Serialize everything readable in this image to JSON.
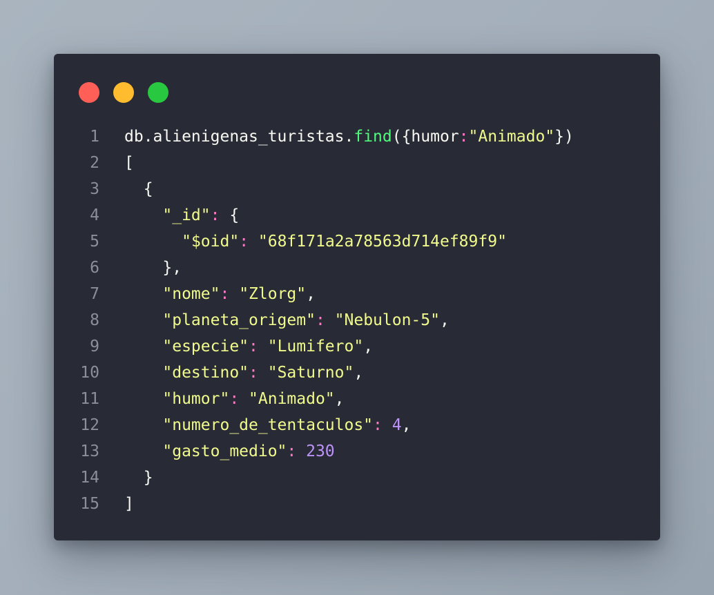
{
  "window": {
    "traffic_lights": [
      {
        "name": "close",
        "color": "#ff5f57"
      },
      {
        "name": "minimize",
        "color": "#febc2e"
      },
      {
        "name": "maximize",
        "color": "#28c840"
      }
    ],
    "theme": {
      "background": "#282a36",
      "default": "#f8f8f2",
      "function": "#50fa7b",
      "string": "#f1fa8c",
      "colon": "#ff79c6",
      "number": "#bd93f9",
      "line_number": "#8b8f99"
    }
  },
  "code": {
    "lines": [
      {
        "num": "1",
        "tokens": [
          {
            "t": "db.alienigenas_turistas.",
            "c": "default"
          },
          {
            "t": "find",
            "c": "func"
          },
          {
            "t": "({humor",
            "c": "default"
          },
          {
            "t": ":",
            "c": "colon"
          },
          {
            "t": "\"Animado\"",
            "c": "string"
          },
          {
            "t": "})",
            "c": "default"
          }
        ]
      },
      {
        "num": "2",
        "tokens": [
          {
            "t": "[",
            "c": "default"
          }
        ]
      },
      {
        "num": "3",
        "tokens": [
          {
            "t": "  {",
            "c": "default"
          }
        ]
      },
      {
        "num": "4",
        "tokens": [
          {
            "t": "    ",
            "c": "default"
          },
          {
            "t": "\"_id\"",
            "c": "key"
          },
          {
            "t": ": ",
            "c": "colon"
          },
          {
            "t": "{",
            "c": "default"
          }
        ]
      },
      {
        "num": "5",
        "tokens": [
          {
            "t": "      ",
            "c": "default"
          },
          {
            "t": "\"$oid\"",
            "c": "key"
          },
          {
            "t": ": ",
            "c": "colon"
          },
          {
            "t": "\"68f171a2a78563d714ef89f9\"",
            "c": "string"
          }
        ]
      },
      {
        "num": "6",
        "tokens": [
          {
            "t": "    },",
            "c": "default"
          }
        ]
      },
      {
        "num": "7",
        "tokens": [
          {
            "t": "    ",
            "c": "default"
          },
          {
            "t": "\"nome\"",
            "c": "key"
          },
          {
            "t": ": ",
            "c": "colon"
          },
          {
            "t": "\"Zlorg\"",
            "c": "string"
          },
          {
            "t": ",",
            "c": "default"
          }
        ]
      },
      {
        "num": "8",
        "tokens": [
          {
            "t": "    ",
            "c": "default"
          },
          {
            "t": "\"planeta_origem\"",
            "c": "key"
          },
          {
            "t": ": ",
            "c": "colon"
          },
          {
            "t": "\"Nebulon-5\"",
            "c": "string"
          },
          {
            "t": ",",
            "c": "default"
          }
        ]
      },
      {
        "num": "9",
        "tokens": [
          {
            "t": "    ",
            "c": "default"
          },
          {
            "t": "\"especie\"",
            "c": "key"
          },
          {
            "t": ": ",
            "c": "colon"
          },
          {
            "t": "\"Lumifero\"",
            "c": "string"
          },
          {
            "t": ",",
            "c": "default"
          }
        ]
      },
      {
        "num": "10",
        "tokens": [
          {
            "t": "    ",
            "c": "default"
          },
          {
            "t": "\"destino\"",
            "c": "key"
          },
          {
            "t": ": ",
            "c": "colon"
          },
          {
            "t": "\"Saturno\"",
            "c": "string"
          },
          {
            "t": ",",
            "c": "default"
          }
        ]
      },
      {
        "num": "11",
        "tokens": [
          {
            "t": "    ",
            "c": "default"
          },
          {
            "t": "\"humor\"",
            "c": "key"
          },
          {
            "t": ": ",
            "c": "colon"
          },
          {
            "t": "\"Animado\"",
            "c": "string"
          },
          {
            "t": ",",
            "c": "default"
          }
        ]
      },
      {
        "num": "12",
        "tokens": [
          {
            "t": "    ",
            "c": "default"
          },
          {
            "t": "\"numero_de_tentaculos\"",
            "c": "key"
          },
          {
            "t": ": ",
            "c": "colon"
          },
          {
            "t": "4",
            "c": "number"
          },
          {
            "t": ",",
            "c": "default"
          }
        ]
      },
      {
        "num": "13",
        "tokens": [
          {
            "t": "    ",
            "c": "default"
          },
          {
            "t": "\"gasto_medio\"",
            "c": "key"
          },
          {
            "t": ": ",
            "c": "colon"
          },
          {
            "t": "230",
            "c": "number"
          }
        ]
      },
      {
        "num": "14",
        "tokens": [
          {
            "t": "  }",
            "c": "default"
          }
        ]
      },
      {
        "num": "15",
        "tokens": [
          {
            "t": "]",
            "c": "default"
          }
        ]
      }
    ]
  }
}
